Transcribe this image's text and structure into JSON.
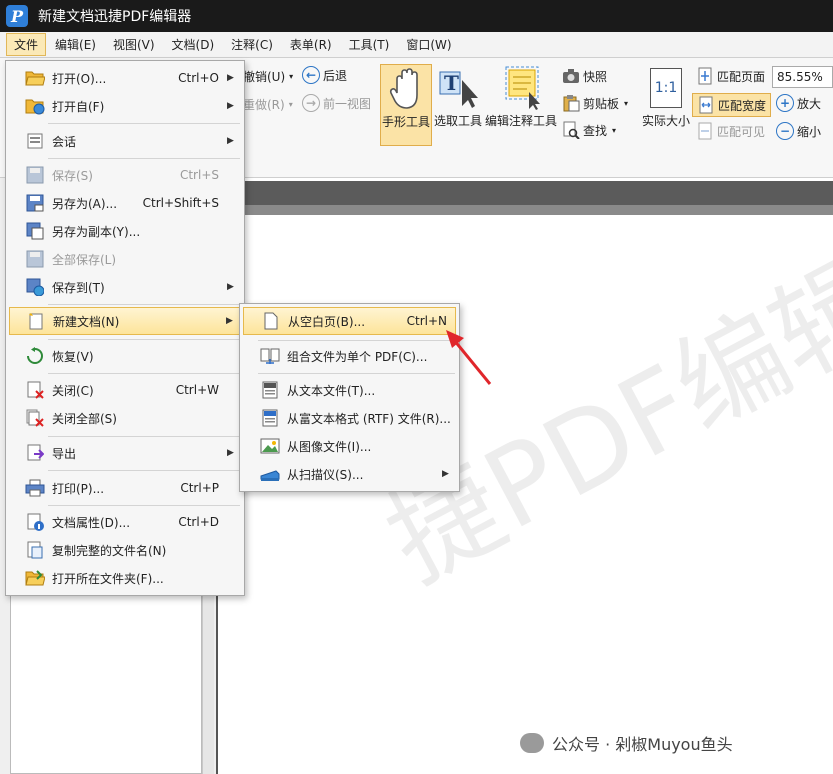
{
  "window": {
    "title": "新建文档迅捷PDF编辑器",
    "logo": "P"
  },
  "menubar": [
    {
      "label": "文件",
      "active": true
    },
    {
      "label": "编辑(E)"
    },
    {
      "label": "视图(V)"
    },
    {
      "label": "文档(D)"
    },
    {
      "label": "注释(C)"
    },
    {
      "label": "表单(R)"
    },
    {
      "label": "工具(T)"
    },
    {
      "label": "窗口(W)"
    }
  ],
  "ribbon": {
    "undo": "撤销(U)",
    "redo": "重做(R)",
    "back": "后退",
    "prev_view": "前一视图",
    "hand_tool": "手形工具",
    "select_tool": "选取工具",
    "edit_annot_tool": "编辑注释工具",
    "snapshot": "快照",
    "clipboard": "剪贴板",
    "find": "查找",
    "actual_size": "实际大小",
    "actual_size_icon": "1:1",
    "fit_page": "匹配页面",
    "fit_width": "匹配宽度",
    "fit_visible": "匹配可见",
    "zoom_value": "85.55%",
    "zoom_in": "放大",
    "zoom_out": "缩小"
  },
  "file_menu": [
    {
      "label": "打开(O)...",
      "shortcut": "Ctrl+O",
      "arrow": true,
      "icon": "folder-open-icon"
    },
    {
      "label": "打开自(F)",
      "shortcut": "",
      "arrow": true,
      "icon": "folder-web-icon"
    },
    {
      "label": "会话",
      "shortcut": "",
      "arrow": true,
      "icon": "session-icon"
    },
    {
      "label": "保存(S)",
      "shortcut": "Ctrl+S",
      "disabled": true,
      "icon": "save-icon"
    },
    {
      "label": "另存为(A)...",
      "shortcut": "Ctrl+Shift+S",
      "icon": "save-as-icon"
    },
    {
      "label": "另存为副本(Y)...",
      "shortcut": "",
      "icon": "save-copy-icon"
    },
    {
      "label": "全部保存(L)",
      "shortcut": "",
      "disabled": true,
      "icon": "save-all-icon"
    },
    {
      "label": "保存到(T)",
      "shortcut": "",
      "arrow": true,
      "icon": "save-to-icon"
    },
    {
      "label": "新建文档(N)",
      "shortcut": "",
      "arrow": true,
      "highlight": true,
      "icon": "new-document-icon"
    },
    {
      "label": "恢复(V)",
      "shortcut": "",
      "icon": "restore-icon"
    },
    {
      "label": "关闭(C)",
      "shortcut": "Ctrl+W",
      "icon": "close-doc-icon"
    },
    {
      "label": "关闭全部(S)",
      "shortcut": "",
      "icon": "close-all-icon"
    },
    {
      "label": "导出",
      "shortcut": "",
      "arrow": true,
      "icon": "export-icon"
    },
    {
      "label": "打印(P)...",
      "shortcut": "Ctrl+P",
      "icon": "print-icon"
    },
    {
      "label": "文档属性(D)...",
      "shortcut": "Ctrl+D",
      "icon": "properties-icon"
    },
    {
      "label": "复制完整的文件名(N)",
      "shortcut": "",
      "icon": "copy-filename-icon"
    },
    {
      "label": "打开所在文件夹(F)...",
      "shortcut": "",
      "icon": "open-folder-icon"
    }
  ],
  "submenu": [
    {
      "label": "从空白页(B)...",
      "shortcut": "Ctrl+N",
      "highlight": true,
      "icon": "blank-page-icon"
    },
    {
      "label": "组合文件为单个 PDF(C)...",
      "shortcut": "",
      "icon": "combine-icon"
    },
    {
      "label": "从文本文件(T)...",
      "shortcut": "",
      "icon": "text-file-icon"
    },
    {
      "label": "从富文本格式 (RTF) 文件(R)...",
      "shortcut": "",
      "icon": "rtf-file-icon"
    },
    {
      "label": "从图像文件(I)...",
      "shortcut": "",
      "icon": "image-file-icon"
    },
    {
      "label": "从扫描仪(S)...",
      "shortcut": "",
      "arrow": true,
      "icon": "scanner-icon"
    }
  ],
  "watermark": "捷PDF编辑器",
  "footer": {
    "wechat_label": "公众号 · 剁椒Muyou鱼头"
  },
  "colors": {
    "titlebar": "#1a1a1a",
    "highlight": "#fde49a",
    "annotation_arrow": "#e0262b"
  }
}
